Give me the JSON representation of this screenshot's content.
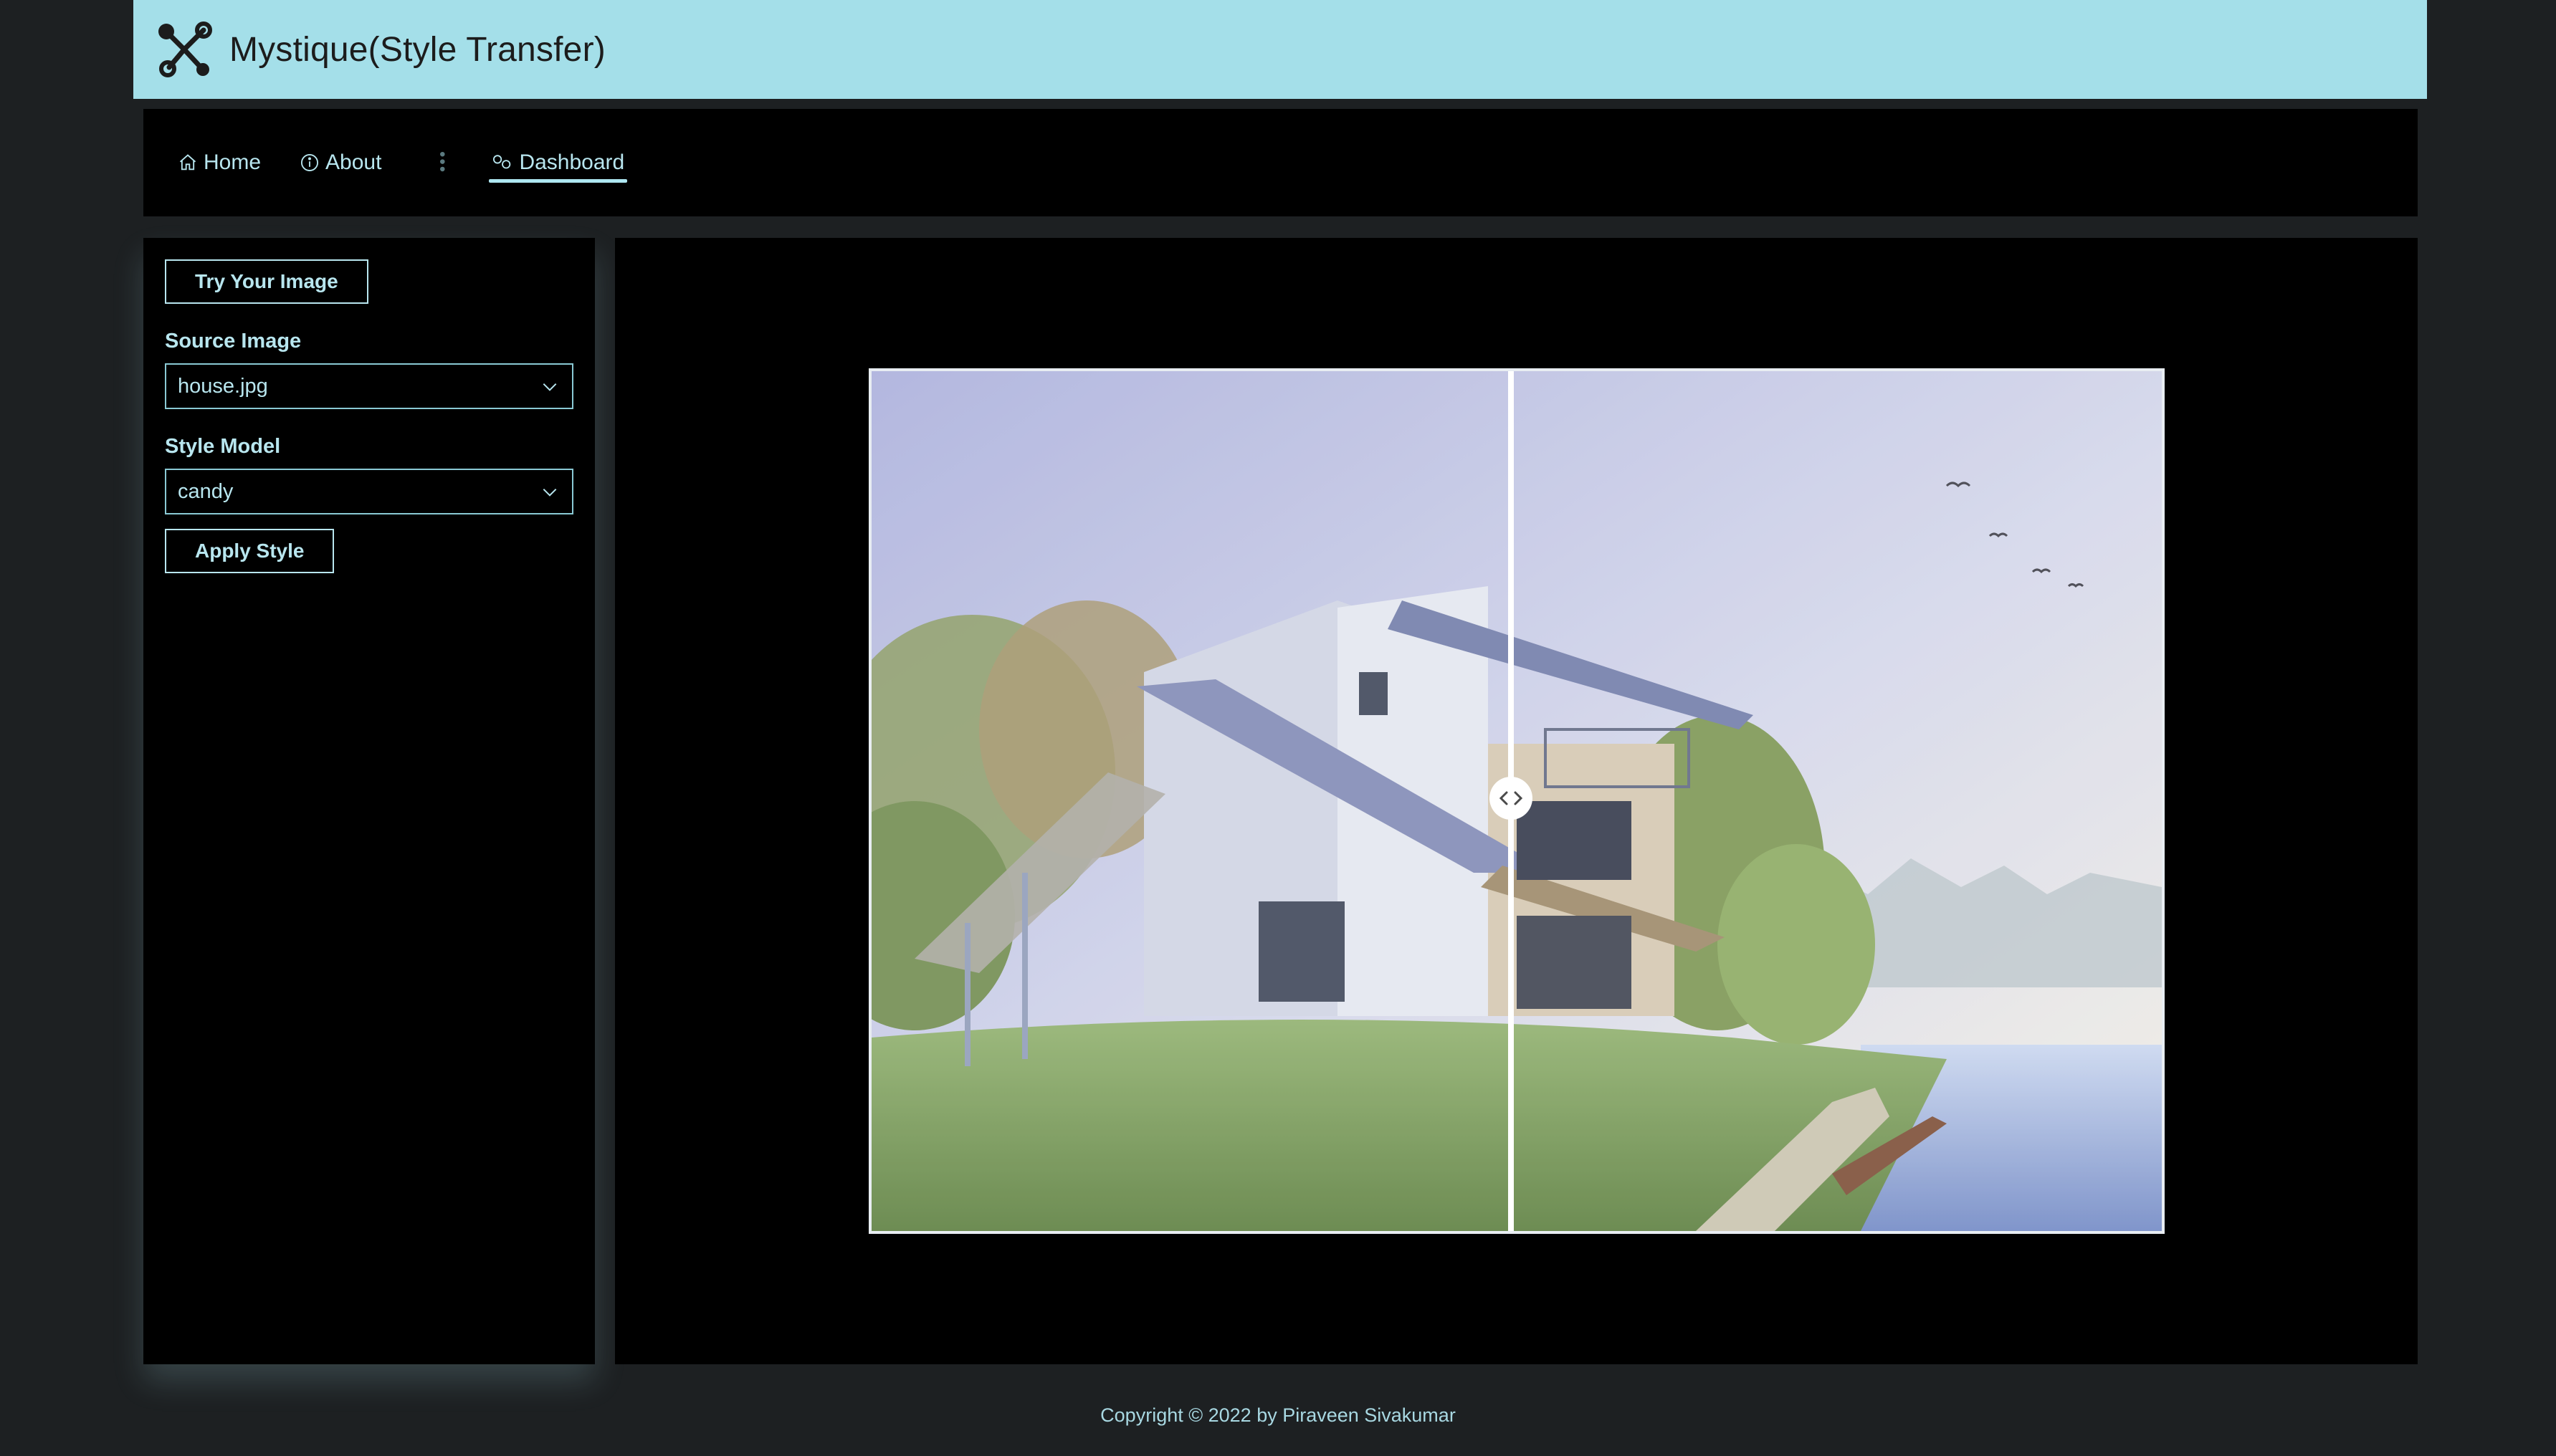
{
  "header": {
    "title": "Mystique(Style Transfer)",
    "logo_icon": "graph-nodes-icon",
    "background": "#a4dfe9"
  },
  "nav": {
    "items": [
      {
        "label": "Home",
        "icon": "home-icon",
        "active": false
      },
      {
        "label": "About",
        "icon": "info-icon",
        "active": false
      },
      {
        "label": "Dashboard",
        "icon": "dashboard-icon",
        "active": true
      }
    ]
  },
  "sidebar": {
    "try_button": "Try Your Image",
    "source_label": "Source Image",
    "source_value": "house.jpg",
    "style_label": "Style Model",
    "style_value": "candy",
    "apply_button": "Apply Style"
  },
  "comparison": {
    "handle_icon": "compare-arrows-icon",
    "slider_position": 0.49
  },
  "footer": {
    "copyright": "Copyright © 2022 by Piraveen Sivakumar"
  },
  "colors": {
    "accent": "#b8e6ef",
    "page_bg": "#1d2022",
    "panel_bg": "#000000"
  }
}
